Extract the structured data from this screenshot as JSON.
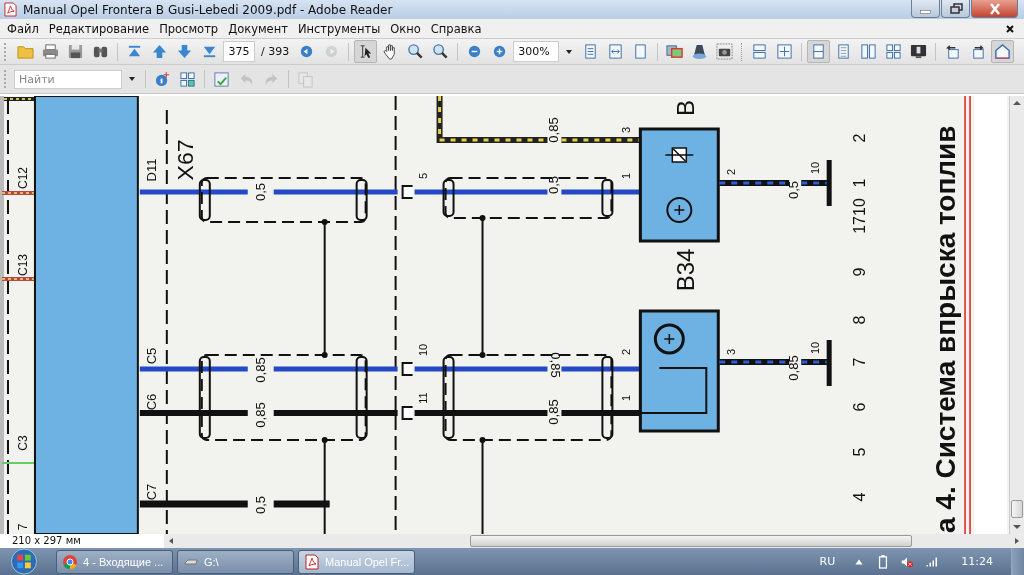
{
  "window": {
    "title": "Manual Opel Frontera B Gusi-Lebedi 2009.pdf - Adobe Reader"
  },
  "menu": [
    "Файл",
    "Редактирование",
    "Просмотр",
    "Документ",
    "Инструменты",
    "Окно",
    "Справка"
  ],
  "toolbar": {
    "file_buttons": [
      {
        "kind": "open",
        "pressed": false,
        "disabled": false
      },
      {
        "kind": "print",
        "pressed": false,
        "disabled": false
      },
      {
        "kind": "save",
        "pressed": false,
        "disabled": false
      },
      {
        "kind": "find",
        "pressed": false,
        "disabled": false
      },
      {
        "kind": "first",
        "pressed": false,
        "disabled": false
      },
      {
        "kind": "prev",
        "pressed": false,
        "disabled": false
      },
      {
        "kind": "next",
        "pressed": false,
        "disabled": false
      },
      {
        "kind": "last",
        "pressed": false,
        "disabled": false
      }
    ],
    "page_number": "375",
    "page_count": "/ 393",
    "history_buttons": [
      {
        "kind": "back",
        "pressed": false,
        "disabled": false
      },
      {
        "kind": "forward",
        "pressed": false,
        "disabled": true
      }
    ],
    "tool_buttons": [
      {
        "kind": "select",
        "pressed": true,
        "disabled": false
      },
      {
        "kind": "hand",
        "pressed": false,
        "disabled": false
      },
      {
        "kind": "marquee",
        "pressed": false,
        "disabled": false
      },
      {
        "kind": "dynamic",
        "pressed": false,
        "disabled": false
      },
      {
        "kind": "zoom_out",
        "pressed": false,
        "disabled": false
      },
      {
        "kind": "zoom_in",
        "pressed": false,
        "disabled": false
      }
    ],
    "zoom": "300%",
    "view_buttons": [
      {
        "kind": "actual_size",
        "pressed": false,
        "disabled": false
      },
      {
        "kind": "fit_width",
        "pressed": false,
        "disabled": false
      },
      {
        "kind": "fit_page",
        "pressed": false,
        "disabled": false
      },
      {
        "kind": "compare",
        "pressed": false,
        "disabled": false
      },
      {
        "kind": "loupe",
        "pressed": false,
        "disabled": false
      },
      {
        "kind": "snapshot",
        "pressed": false,
        "disabled": false
      },
      {
        "kind": "split",
        "pressed": false,
        "disabled": false
      },
      {
        "kind": "full_screen",
        "pressed": false,
        "disabled": false
      },
      {
        "kind": "single",
        "pressed": true,
        "disabled": false
      },
      {
        "kind": "continuous",
        "pressed": false,
        "disabled": false
      },
      {
        "kind": "two_up",
        "pressed": false,
        "disabled": false
      },
      {
        "kind": "two_up_continuous",
        "pressed": false,
        "disabled": false
      },
      {
        "kind": "monitor",
        "pressed": false,
        "disabled": false
      },
      {
        "kind": "rotate_left",
        "pressed": false,
        "disabled": false
      },
      {
        "kind": "rotate_right",
        "pressed": false,
        "disabled": false
      },
      {
        "kind": "read",
        "pressed": true,
        "disabled": false
      }
    ]
  },
  "find_bar": {
    "placeholder": "Найти",
    "buttons": [
      {
        "kind": "info",
        "pressed": false,
        "disabled": false
      },
      {
        "kind": "grid",
        "pressed": false,
        "disabled": false
      },
      {
        "kind": "spell",
        "pressed": false,
        "disabled": false
      },
      {
        "kind": "undo",
        "pressed": false,
        "disabled": true
      },
      {
        "kind": "redo",
        "pressed": false,
        "disabled": true
      },
      {
        "kind": "copy",
        "pressed": false,
        "disabled": true
      }
    ]
  },
  "document": {
    "left_column_labels": [
      "C12",
      "C13",
      "C3",
      "7"
    ],
    "connector": "X67",
    "connector_pins": [
      "D11",
      "C5",
      "C6",
      "C7"
    ],
    "wire_sizes_a": [
      "0,5",
      "0,85",
      "0,85",
      "0,5"
    ],
    "junction_pins": [
      "5",
      "10",
      "11"
    ],
    "wire_sizes_b": [
      "0,85",
      "0,5",
      "0,85",
      "0,85"
    ],
    "sensor_pins_in": [
      "3",
      "1",
      "2",
      "1"
    ],
    "sensors": [
      "B",
      "B34"
    ],
    "sensor_pins_out": [
      "2",
      "3"
    ],
    "ground_wire_sizes": [
      "0,5",
      "0,85"
    ],
    "ground_points": [
      "10",
      "10"
    ],
    "grid_numbers": [
      "2",
      "1",
      "1710",
      "9",
      "8",
      "7",
      "6",
      "5",
      "4"
    ],
    "caption": "а 4. Система впрыска топлив"
  },
  "status": {
    "page_size": "210 x 297 мм"
  },
  "taskbar": {
    "items": [
      {
        "label": "4 - Входящие ...",
        "kind": "browser",
        "selected": false
      },
      {
        "label": "G:\\",
        "kind": "drive",
        "selected": false
      },
      {
        "label": "Manual Opel Fr...",
        "kind": "pdf",
        "selected": true
      }
    ],
    "language": "RU",
    "time": "11:24"
  }
}
